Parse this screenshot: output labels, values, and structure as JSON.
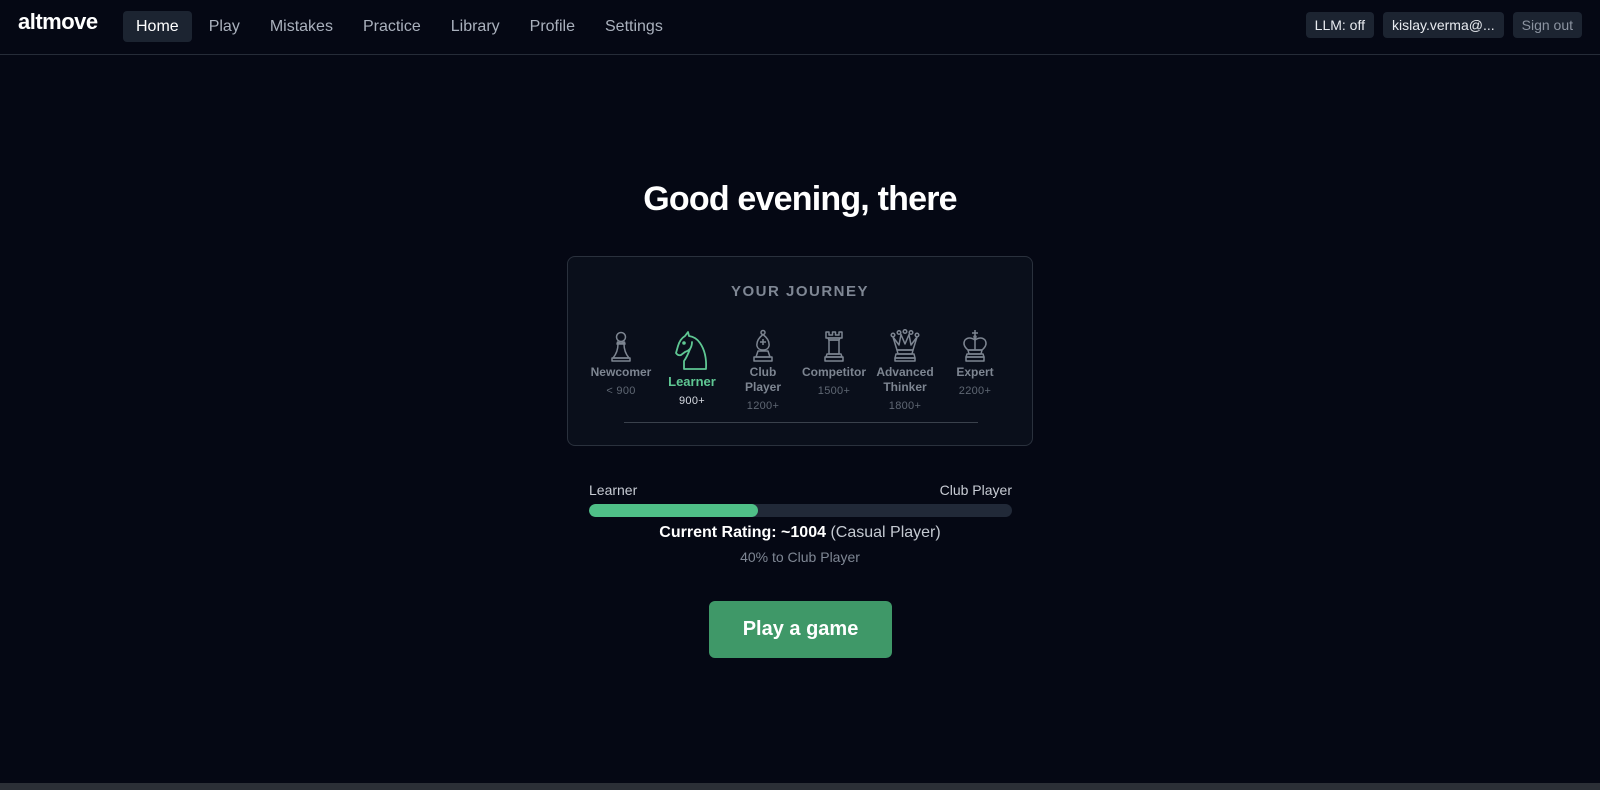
{
  "app": {
    "logo": "altmove"
  },
  "nav": {
    "items": [
      {
        "label": "Home",
        "active": true
      },
      {
        "label": "Play"
      },
      {
        "label": "Mistakes"
      },
      {
        "label": "Practice"
      },
      {
        "label": "Library"
      },
      {
        "label": "Profile"
      },
      {
        "label": "Settings"
      }
    ]
  },
  "header_right": {
    "llm_status": "LLM: off",
    "user": "kislay.verma@...",
    "sign_out": "Sign out"
  },
  "main": {
    "greeting": "Good evening, there",
    "journey": {
      "title": "YOUR JOURNEY",
      "stages": [
        {
          "name": "Newcomer",
          "rating": "< 900",
          "icon": "pawn-icon"
        },
        {
          "name": "Learner",
          "rating": "900+",
          "icon": "knight-icon",
          "current": true
        },
        {
          "name": "Club Player",
          "rating": "1200+",
          "icon": "bishop-icon"
        },
        {
          "name": "Competitor",
          "rating": "1500+",
          "icon": "rook-icon"
        },
        {
          "name": "Advanced Thinker",
          "rating": "1800+",
          "icon": "queen-icon"
        },
        {
          "name": "Expert",
          "rating": "2200+",
          "icon": "king-icon"
        }
      ]
    },
    "progress": {
      "from": "Learner",
      "to": "Club Player",
      "fraction": 0.4,
      "rating_label": "Current Rating: ~1004",
      "rating_tier": "(Casual Player)",
      "percent_text": "40% to Club Player"
    },
    "cta": "Play a game"
  },
  "colors": {
    "background": "#050814",
    "accent": "#4fbf87",
    "button": "#3f9868"
  }
}
